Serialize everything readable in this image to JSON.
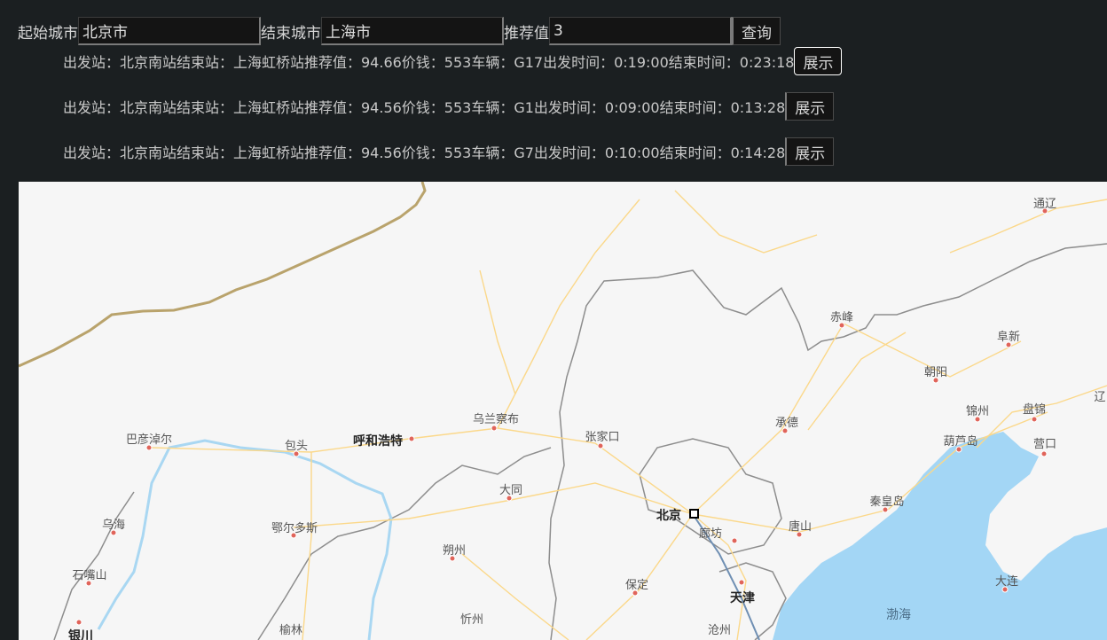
{
  "form": {
    "start_label": "起始城市",
    "start_value": "北京市",
    "end_label": "结束城市",
    "end_value": "上海市",
    "score_label": "推荐值",
    "score_value": "3",
    "query_button": "查询"
  },
  "results": [
    {
      "text": "出发站：北京南站结束站：上海虹桥站推荐值：94.66价钱：553车辆：G17出发时间：0:19:00结束时间：0:23:18",
      "button": "展示"
    },
    {
      "text": "出发站：北京南站结束站：上海虹桥站推荐值：94.56价钱：553车辆：G1出发时间：0:09:00结束时间：0:13:28",
      "button": "展示"
    },
    {
      "text": "出发站：北京南站结束站：上海虹桥站推荐值：94.56价钱：553车辆：G7出发时间：0:10:00结束时间：0:14:28",
      "button": "展示"
    }
  ],
  "map": {
    "cities": {
      "tongliao": "通辽",
      "chifeng": "赤峰",
      "fuxin": "阜新",
      "chaoyang": "朝阳",
      "jinzhou": "锦州",
      "panjin": "盘锦",
      "liao": "辽",
      "bayannur": "巴彦淖尔",
      "baotou": "包头",
      "hohhot": "呼和浩特",
      "ulanqab": "乌兰察布",
      "zhangjiakou": "张家口",
      "chengde": "承德",
      "huludao": "葫芦岛",
      "yingkou": "营口",
      "wuhai": "乌海",
      "ordos": "鄂尔多斯",
      "datong": "大同",
      "beijing": "北京",
      "langfang": "廊坊",
      "tangshan": "唐山",
      "qinhuangdao": "秦皇岛",
      "shizuishan": "石嘴山",
      "shuozhou": "朔州",
      "baoding": "保定",
      "tianjin": "天津",
      "dalian": "大连",
      "bohai": "渤海",
      "yinchuan": "银川",
      "yulin": "榆林",
      "xinzhou": "忻州",
      "cangzhou": "沧州"
    },
    "colors": {
      "land": "#f6f6f6",
      "sea": "#a3d6f5",
      "road": "#fbd88a",
      "border": "#8d8d8d",
      "national_border": "#b9a36c",
      "river": "#a9d7f2",
      "route": "#6f8fb3"
    }
  }
}
